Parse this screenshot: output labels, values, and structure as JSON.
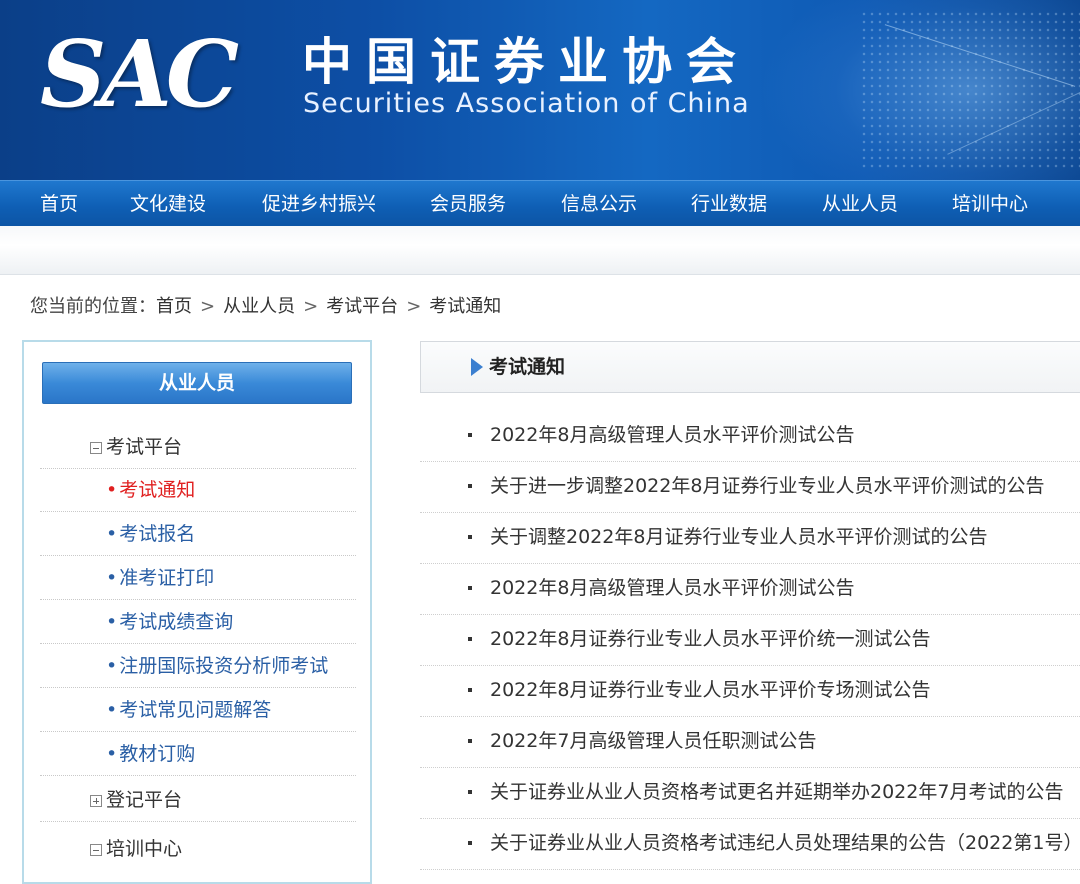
{
  "header": {
    "logo": "SAC",
    "org_name_cn": "中国证券业协会",
    "org_name_en": "Securities Association of China"
  },
  "nav": {
    "items": [
      "首页",
      "文化建设",
      "促进乡村振兴",
      "会员服务",
      "信息公示",
      "行业数据",
      "从业人员",
      "培训中心"
    ]
  },
  "breadcrumb": {
    "prefix": "您当前的位置：",
    "items": [
      "首页",
      "从业人员",
      "考试平台",
      "考试通知"
    ],
    "separator": ">"
  },
  "sidebar": {
    "title": "从业人员",
    "groups": [
      {
        "label": "考试平台",
        "toggle": "minus"
      },
      {
        "label": "登记平台",
        "toggle": "plus"
      },
      {
        "label": "培训中心",
        "toggle": "minus"
      }
    ],
    "sub_items": [
      {
        "label": "考试通知",
        "active": true
      },
      {
        "label": "考试报名",
        "active": false
      },
      {
        "label": "准考证打印",
        "active": false
      },
      {
        "label": "考试成绩查询",
        "active": false
      },
      {
        "label": "注册国际投资分析师考试",
        "active": false
      },
      {
        "label": "考试常见问题解答",
        "active": false
      },
      {
        "label": "教材订购",
        "active": false
      }
    ],
    "bullet": "•"
  },
  "main": {
    "section_title": "考试通知",
    "notices": [
      "2022年8月高级管理人员水平评价测试公告",
      "关于进一步调整2022年8月证券行业专业人员水平评价测试的公告",
      "关于调整2022年8月证券行业专业人员水平评价测试的公告",
      "2022年8月高级管理人员水平评价测试公告",
      "2022年8月证券行业专业人员水平评价统一测试公告",
      "2022年8月证券行业专业人员水平评价专场测试公告",
      "2022年7月高级管理人员任职测试公告",
      "关于证券业从业人员资格考试更名并延期举办2022年7月考试的公告",
      "关于证券业从业人员资格考试违纪人员处理结果的公告（2022第1号）"
    ]
  },
  "colors": {
    "banner": "#0d4fa6",
    "nav": "#0f5fb5",
    "active_link": "#e02020",
    "sidebar_link": "#2a5fa5",
    "sidebar_border": "#b8dbe9"
  }
}
